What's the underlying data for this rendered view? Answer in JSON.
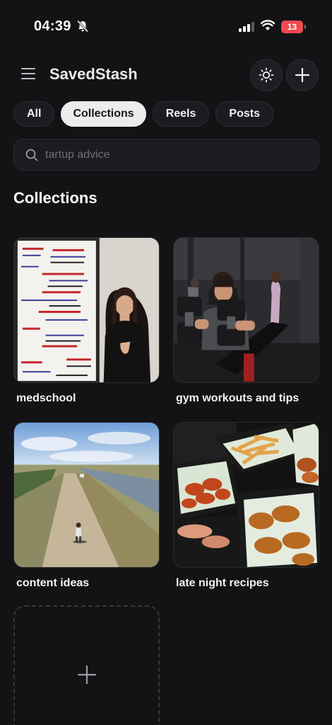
{
  "status_bar": {
    "time": "04:39",
    "battery_level": "13",
    "icons": [
      "bell-slash-icon",
      "signal-icon",
      "wifi-icon",
      "battery-icon"
    ]
  },
  "header": {
    "title": "SavedStash",
    "menu_icon": "hamburger-menu-icon",
    "theme_icon": "sun-icon",
    "add_icon": "plus-icon"
  },
  "tabs": [
    {
      "label": "All",
      "active": false
    },
    {
      "label": "Collections",
      "active": true
    },
    {
      "label": "Reels",
      "active": false
    },
    {
      "label": "Posts",
      "active": false
    }
  ],
  "search": {
    "placeholder": "tartup advice",
    "value": ""
  },
  "section": {
    "title": "Collections"
  },
  "collections": [
    {
      "name": "medschool"
    },
    {
      "name": "gym workouts and tips"
    },
    {
      "name": "content ideas"
    },
    {
      "name": "late night recipes"
    }
  ],
  "new_collection": {
    "icon": "plus-icon"
  },
  "colors": {
    "background": "#131316",
    "surface": "#1c1c20",
    "active_tab": "#ececee",
    "battery_low": "#ef4a4f"
  }
}
